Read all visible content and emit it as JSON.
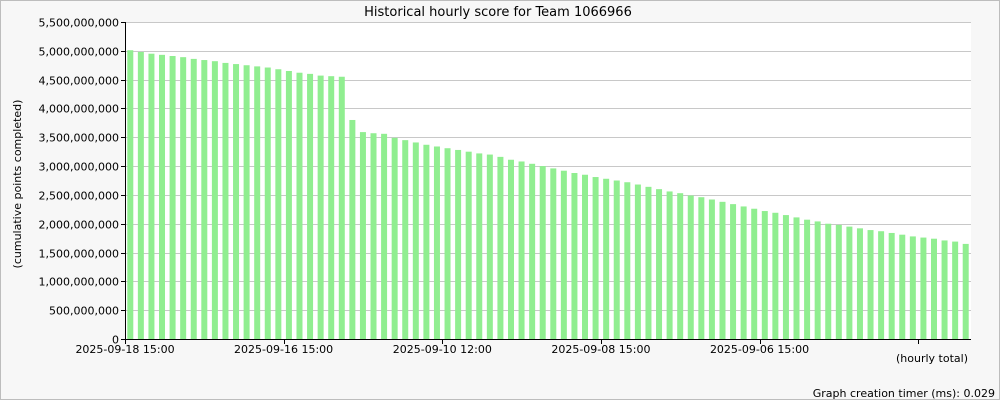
{
  "chart_data": {
    "type": "bar",
    "title": "Historical hourly score for Team 1066966",
    "ylabel": "(cumulative points completed)",
    "xlabel": "(hourly total)",
    "ylim": [
      0,
      5500000000
    ],
    "yticks": [
      "0",
      "500,000,000",
      "1,000,000,000",
      "1,500,000,000",
      "2,000,000,000",
      "2,500,000,000",
      "3,000,000,000",
      "3,500,000,000",
      "4,000,000,000",
      "4,500,000,000",
      "5,000,000,000",
      "5,500,000,000"
    ],
    "xtick_labels": [
      {
        "label": "2025-09-18 15:00",
        "index": 0
      },
      {
        "label": "2025-09-16 15:00",
        "index": 15
      },
      {
        "label": "2025-09-10 12:00",
        "index": 30
      },
      {
        "label": "2025-09-08 15:00",
        "index": 45
      },
      {
        "label": "2025-09-06 15:00",
        "index": 60
      }
    ],
    "bar_color": "#90ee90",
    "grid": true,
    "values": [
      5010000000,
      4980000000,
      4950000000,
      4930000000,
      4910000000,
      4890000000,
      4860000000,
      4840000000,
      4820000000,
      4790000000,
      4770000000,
      4750000000,
      4730000000,
      4710000000,
      4680000000,
      4650000000,
      4620000000,
      4600000000,
      4570000000,
      4560000000,
      4550000000,
      3800000000,
      3590000000,
      3570000000,
      3560000000,
      3490000000,
      3450000000,
      3410000000,
      3370000000,
      3340000000,
      3310000000,
      3280000000,
      3250000000,
      3220000000,
      3200000000,
      3160000000,
      3110000000,
      3080000000,
      3040000000,
      3000000000,
      2960000000,
      2920000000,
      2880000000,
      2850000000,
      2810000000,
      2780000000,
      2750000000,
      2720000000,
      2680000000,
      2640000000,
      2600000000,
      2560000000,
      2530000000,
      2490000000,
      2460000000,
      2420000000,
      2380000000,
      2340000000,
      2300000000,
      2260000000,
      2220000000,
      2190000000,
      2150000000,
      2110000000,
      2070000000,
      2040000000,
      2000000000,
      1980000000,
      1950000000,
      1920000000,
      1890000000,
      1870000000,
      1840000000,
      1810000000,
      1780000000,
      1760000000,
      1740000000,
      1710000000,
      1690000000,
      1650000000
    ]
  },
  "footer": {
    "timer_text": "Graph creation timer (ms): 0.029"
  }
}
